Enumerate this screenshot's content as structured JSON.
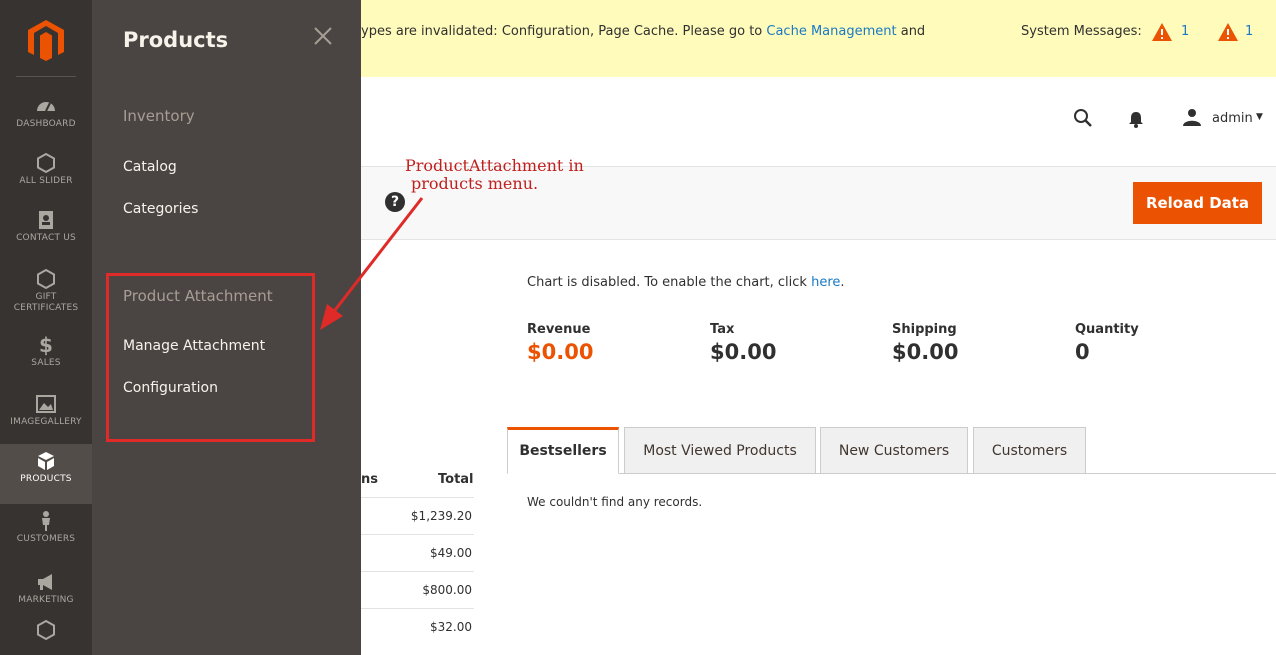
{
  "nav": {
    "items": [
      {
        "label": "DASHBOARD",
        "icon": "dashboard-icon"
      },
      {
        "label": "ALL SLIDER",
        "icon": "hexagon-icon"
      },
      {
        "label": "CONTACT US",
        "icon": "contact-icon"
      },
      {
        "label": "GIFT CERTIFICATES",
        "icon": "hexagon-icon"
      },
      {
        "label": "SALES",
        "icon": "dollar-icon"
      },
      {
        "label": "IMAGEGALLERY",
        "icon": "image-icon"
      },
      {
        "label": "PRODUCTS",
        "icon": "box-icon"
      },
      {
        "label": "CUSTOMERS",
        "icon": "person-icon"
      },
      {
        "label": "MARKETING",
        "icon": "megaphone-icon"
      }
    ]
  },
  "flyout": {
    "title": "Products",
    "inventory_heading": "Inventory",
    "catalog": "Catalog",
    "categories": "Categories",
    "attachment_heading": "Product Attachment",
    "manage_attachment": "Manage Attachment",
    "configuration": "Configuration"
  },
  "messages": {
    "text": "ypes are invalidated: Configuration, Page Cache. Please go to ",
    "link": "Cache Management",
    "tail": " and",
    "system_label": "System Messages:",
    "count_1": "1",
    "count_2": "1"
  },
  "header": {
    "user": "admin"
  },
  "actions": {
    "help": "?",
    "reload": "Reload Data"
  },
  "annotation": {
    "line1": "ProductAttachment in",
    "line2": "products menu."
  },
  "dashboard": {
    "chart_msg": "Chart is disabled. To enable the chart, click ",
    "chart_link": "here",
    "chart_end": ".",
    "totals": [
      {
        "label": "Revenue",
        "value": "$0.00"
      },
      {
        "label": "Tax",
        "value": "$0.00"
      },
      {
        "label": "Shipping",
        "value": "$0.00"
      },
      {
        "label": "Quantity",
        "value": "0"
      }
    ],
    "tabs": [
      "Bestsellers",
      "Most Viewed Products",
      "New Customers",
      "Customers"
    ],
    "no_records": "We couldn't find any records."
  },
  "table": {
    "col_partial": "ns",
    "col_total": "Total",
    "rows": [
      "$1,239.20",
      "$49.00",
      "$800.00",
      "$32.00"
    ]
  },
  "colors": {
    "accent": "#eb5202",
    "link": "#1979c3",
    "nav_bg": "#373330",
    "flyout_bg": "#4a4542",
    "annotation": "#e02a28"
  }
}
